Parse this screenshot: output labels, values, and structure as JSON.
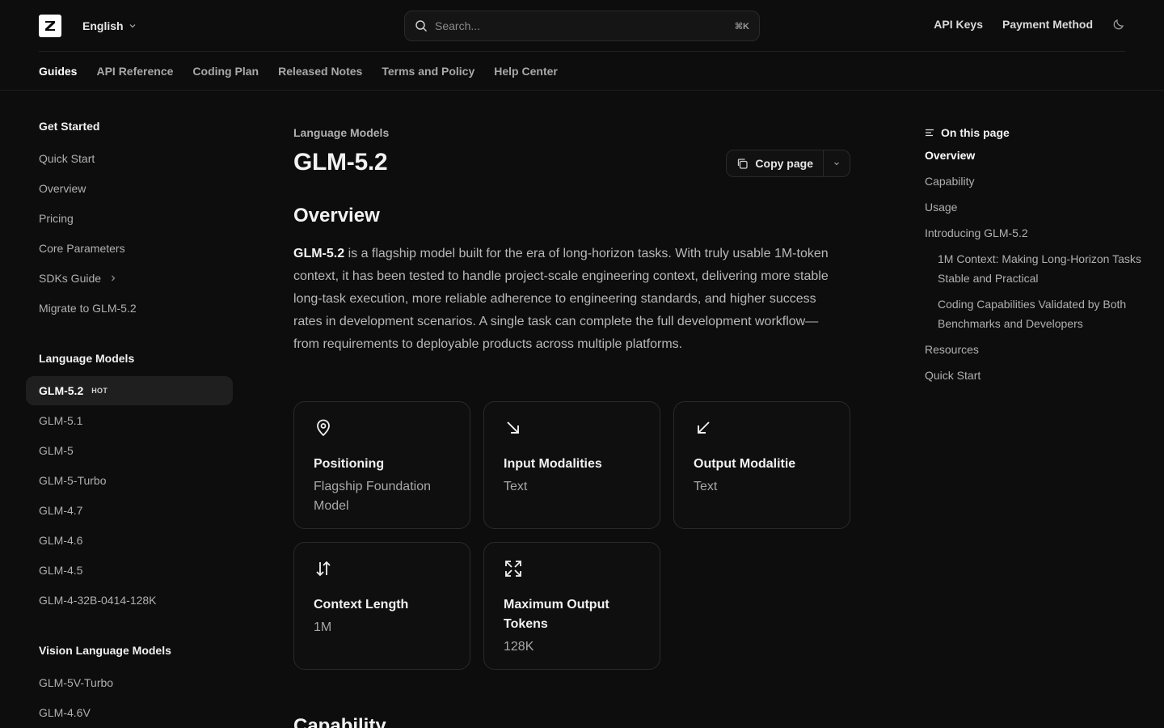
{
  "header": {
    "language": "English",
    "search_placeholder": "Search...",
    "search_shortcut": "⌘K",
    "links": [
      "API Keys",
      "Payment Method"
    ]
  },
  "tabs": [
    "Guides",
    "API Reference",
    "Coding Plan",
    "Released Notes",
    "Terms and Policy",
    "Help Center"
  ],
  "sidebar": {
    "sections": [
      {
        "heading": "Get Started",
        "items": [
          "Quick Start",
          "Overview",
          "Pricing",
          "Core Parameters",
          "SDKs Guide",
          "Migrate to GLM-5.2"
        ]
      },
      {
        "heading": "Language Models",
        "items": [
          "GLM-5.2",
          "GLM-5.1",
          "GLM-5",
          "GLM-5-Turbo",
          "GLM-4.7",
          "GLM-4.6",
          "GLM-4.5",
          "GLM-4-32B-0414-128K"
        ]
      },
      {
        "heading": "Vision Language Models",
        "items": [
          "GLM-5V-Turbo",
          "GLM-4.6V"
        ]
      }
    ],
    "active_badge": "HOT"
  },
  "main": {
    "eyebrow": "Language Models",
    "title": "GLM-5.2",
    "copy_label": "Copy page",
    "overview_heading": "Overview",
    "para_lead": "GLM-5.2",
    "para_text": " is a flagship model built for the era of long-horizon tasks. With truly usable 1M-token context, it has been tested to handle project-scale engineering context, delivering more stable long-task execution, more reliable adherence to engineering standards, and higher success rates in development scenarios. A single task can complete the full development workflow—from requirements to deployable products across multiple platforms.",
    "cards": [
      {
        "title": "Positioning",
        "value": "Flagship Foundation Model",
        "icon": "map-pin-icon"
      },
      {
        "title": "Input Modalities",
        "value": "Text",
        "icon": "arrow-down-right-icon"
      },
      {
        "title": "Output Modalitie",
        "value": "Text",
        "icon": "arrow-down-left-icon"
      },
      {
        "title": "Context Length",
        "value": "1M",
        "icon": "arrows-up-down-icon"
      },
      {
        "title": "Maximum Output Tokens",
        "value": "128K",
        "icon": "expand-icon"
      }
    ],
    "next_heading": "Capability"
  },
  "toc": {
    "heading": "On this page",
    "items": [
      "Overview",
      "Capability",
      "Usage",
      "Introducing GLM-5.2",
      "1M Context: Making Long-Horizon Tasks Stable and Practical",
      "Coding Capabilities Validated by Both Benchmarks and Developers",
      "Resources",
      "Quick Start"
    ]
  }
}
